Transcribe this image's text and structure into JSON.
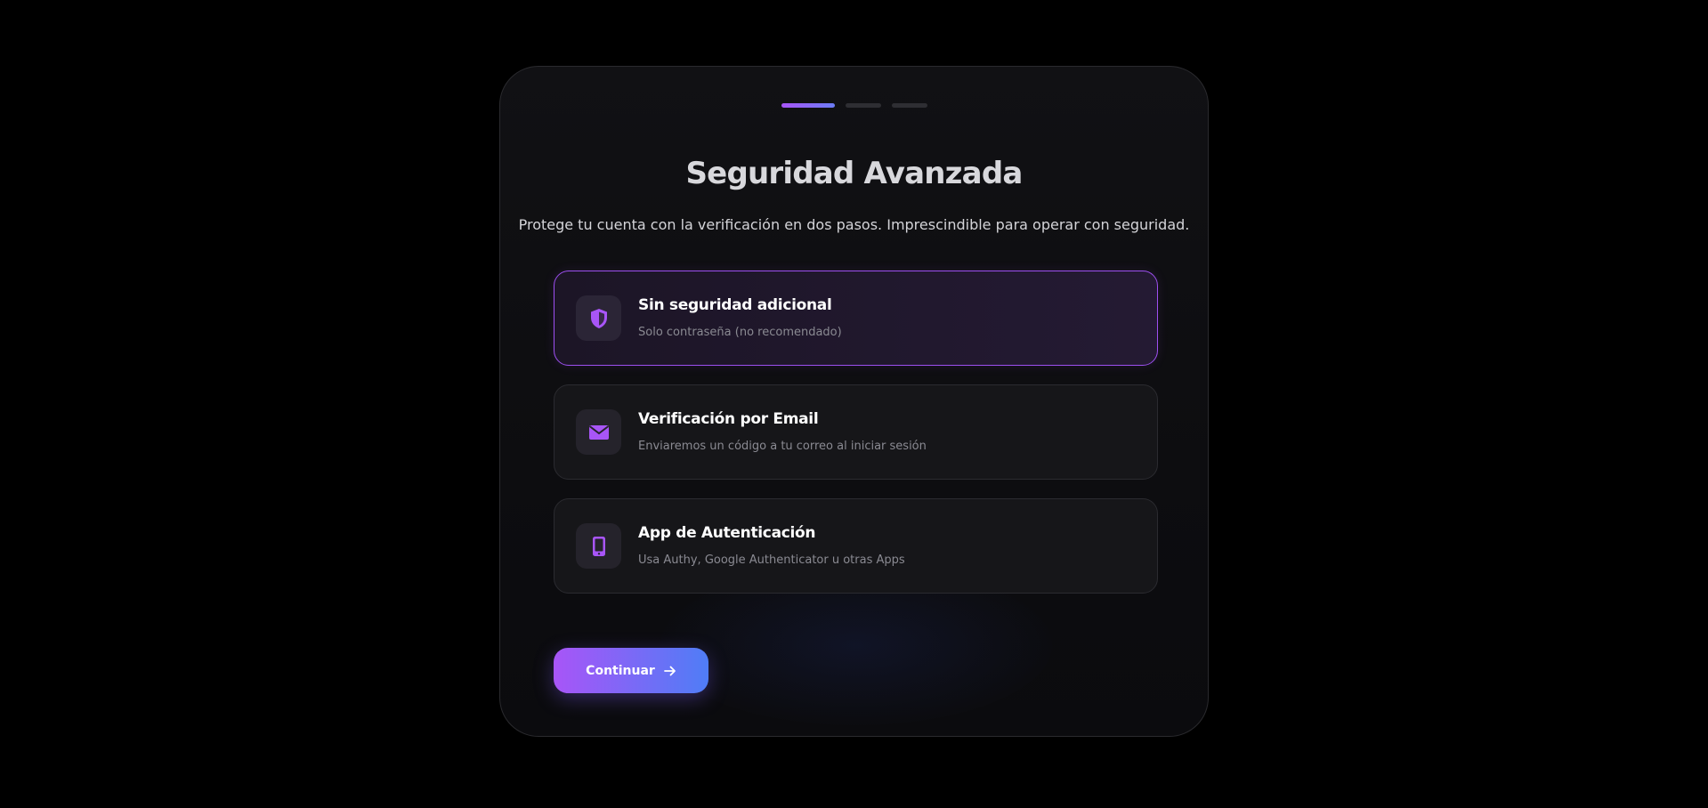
{
  "colors": {
    "accent_purple": "#a855f7",
    "accent_blue": "#4f7df6",
    "background": "#000000",
    "card": "#111114"
  },
  "progress": {
    "total_steps": 3,
    "current_step": 1
  },
  "header": {
    "title": "Seguridad Avanzada",
    "subtitle": "Protege tu cuenta con la verificación en dos pasos. Imprescindible para operar con seguridad."
  },
  "options": [
    {
      "title": "Sin seguridad adicional",
      "description": "Solo contraseña (no recomendado)",
      "icon": "shield-icon",
      "selected": true
    },
    {
      "title": "Verificación por Email",
      "description": "Enviaremos un código a tu correo al iniciar sesión",
      "icon": "envelope-icon",
      "selected": false
    },
    {
      "title": "App de Autenticación",
      "description": "Usa Authy, Google Authenticator u otras Apps",
      "icon": "smartphone-icon",
      "selected": false
    }
  ],
  "actions": {
    "continue_label": "Continuar",
    "continue_icon": "arrow-right-icon"
  }
}
